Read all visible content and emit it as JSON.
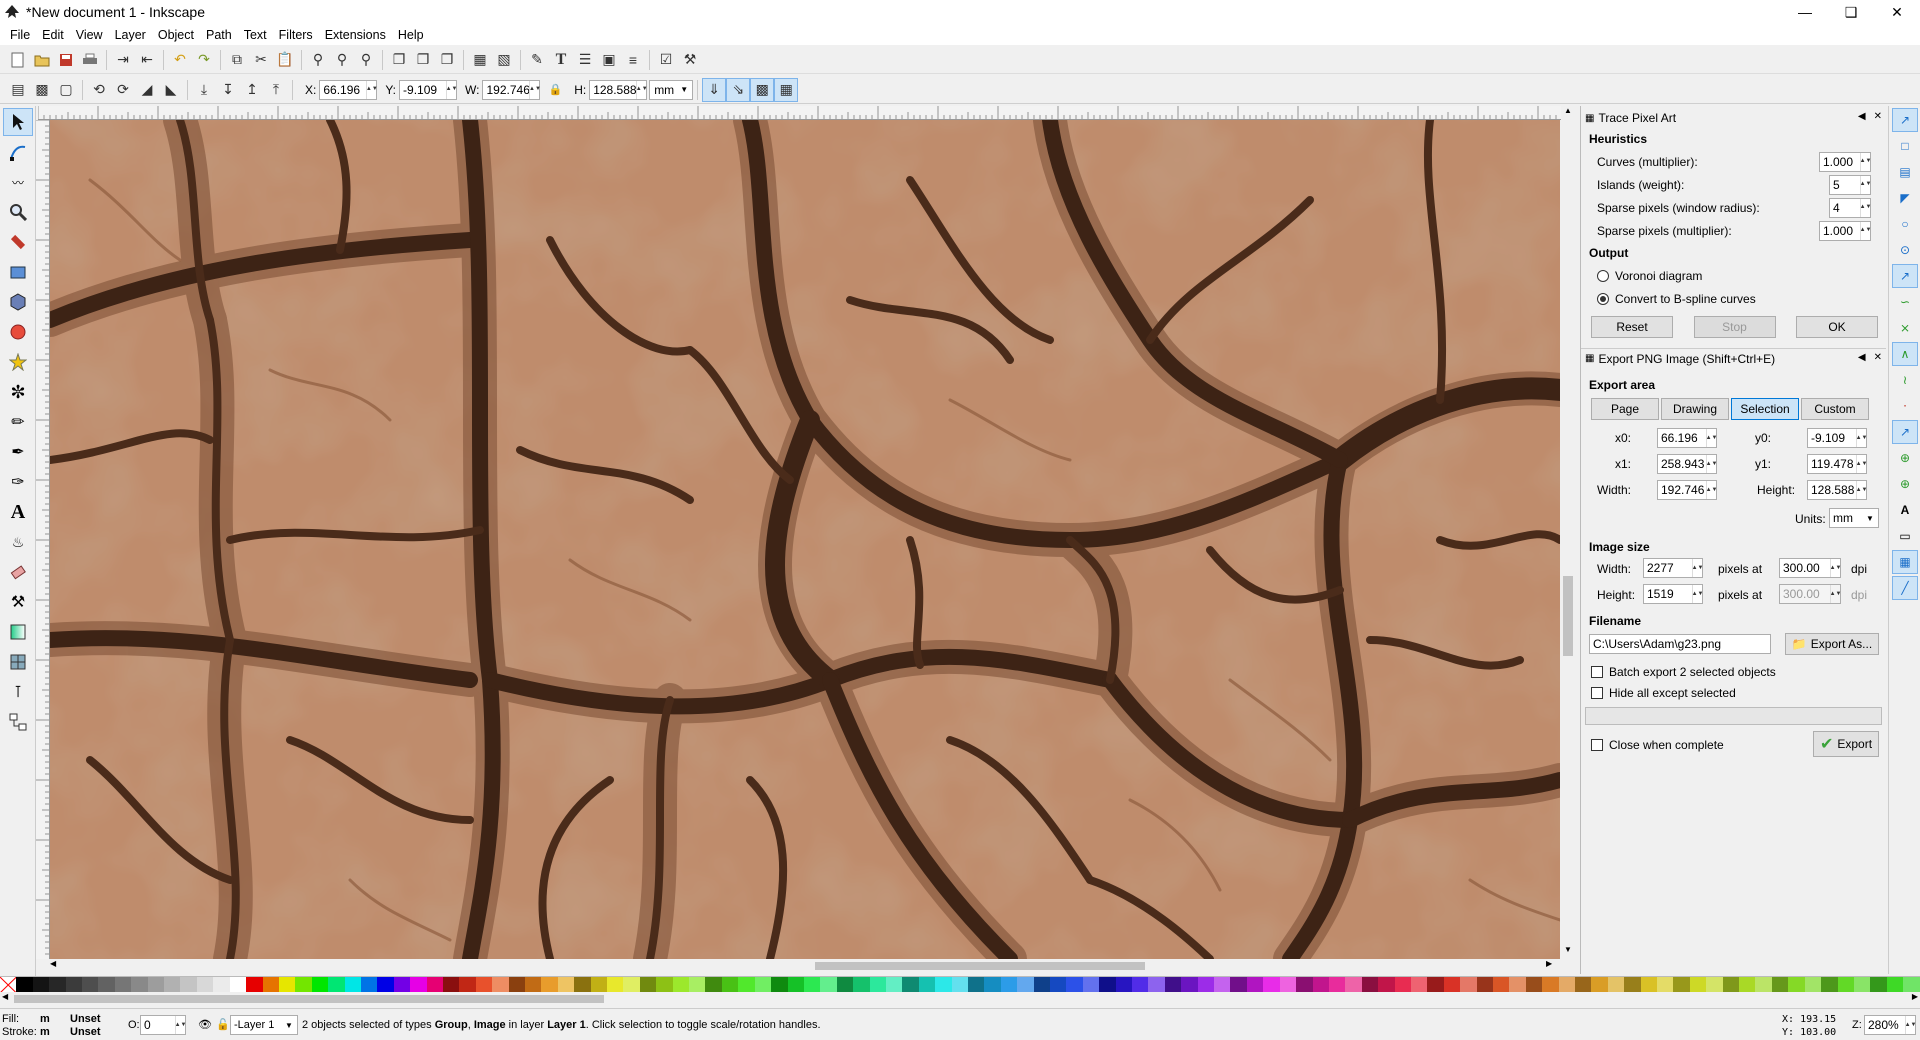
{
  "window": {
    "title": "*New document 1 - Inkscape"
  },
  "menu": [
    "File",
    "Edit",
    "View",
    "Layer",
    "Object",
    "Path",
    "Text",
    "Filters",
    "Extensions",
    "Help"
  ],
  "selectbar": {
    "x_label": "X:",
    "x": "66.196",
    "y_label": "Y:",
    "y": "-9.109",
    "w_label": "W:",
    "w": "192.746",
    "h_label": "H:",
    "h": "128.588",
    "unit": "mm"
  },
  "trace": {
    "title": "Trace Pixel Art",
    "heuristics": "Heuristics",
    "curves_label": "Curves (multiplier):",
    "curves": "1.000",
    "islands_label": "Islands (weight):",
    "islands": "5",
    "sparse_radius_label": "Sparse pixels (window radius):",
    "sparse_radius": "4",
    "sparse_mult_label": "Sparse pixels (multiplier):",
    "sparse_mult": "1.000",
    "output": "Output",
    "voronoi": "Voronoi diagram",
    "bspline": "Convert to B-spline curves",
    "reset": "Reset",
    "stop": "Stop",
    "ok": "OK"
  },
  "export": {
    "title": "Export PNG Image (Shift+Ctrl+E)",
    "area": "Export area",
    "tabs": [
      "Page",
      "Drawing",
      "Selection",
      "Custom"
    ],
    "x0_label": "x0:",
    "x0": "66.196",
    "y0_label": "y0:",
    "y0": "-9.109",
    "x1_label": "x1:",
    "x1": "258.943",
    "y1_label": "y1:",
    "y1": "119.478",
    "width_label": "Width:",
    "width": "192.746",
    "height_label": "Height:",
    "height": "128.588",
    "units_label": "Units:",
    "units": "mm",
    "image_size": "Image size",
    "img_w_label": "Width:",
    "img_w": "2277",
    "img_h_label": "Height:",
    "img_h": "1519",
    "pixels_at": "pixels at",
    "dpi1": "300.00",
    "dpi2": "300.00",
    "dpi": "dpi",
    "filename_label": "Filename",
    "filename": "C:\\Users\\Adam\\g23.png",
    "export_as": "Export As...",
    "batch": "Batch export 2 selected objects",
    "hide": "Hide all except selected",
    "close_when": "Close when complete",
    "export": "Export"
  },
  "status": {
    "fill_label": "Fill:",
    "fill_m": "m",
    "fill_val": "Unset",
    "stroke_label": "Stroke:",
    "stroke_m": "m",
    "stroke_val": "Unset",
    "opacity_label": "O:",
    "opacity": "0",
    "layer": "-Layer 1",
    "msg_pre": "2 objects selected of types ",
    "msg_b1": "Group",
    "msg_mid1": ", ",
    "msg_b2": "Image",
    "msg_mid2": " in layer ",
    "msg_b3": "Layer 1",
    "msg_post": ". Click selection to toggle scale/rotation handles.",
    "x_label": "X:",
    "x": "193.15",
    "y_label": "Y:",
    "y": "103.00",
    "z_label": "Z:",
    "zoom": "280%"
  },
  "colors": {
    "accent": "#0078d7",
    "mud": "#b58262",
    "crack": "#3d2315",
    "dark": "#7a4d33",
    "light": "#c9967a"
  }
}
